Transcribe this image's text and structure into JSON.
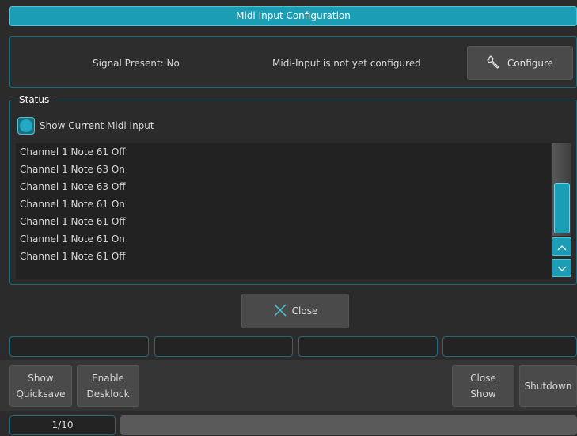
{
  "window": {
    "title": "Midi Input Configuration"
  },
  "top_panel": {
    "signal_text": "Signal Present: No",
    "config_status_text": "Midi-Input is not yet configured",
    "configure_label": "Configure",
    "configure_icon": "wrench-icon"
  },
  "status": {
    "legend": "Status",
    "toggle_label": "Show Current Midi Input",
    "toggle_checked": true,
    "messages": [
      "Channel 1 Note 61 Off",
      "Channel 1 Note 63 On",
      "Channel 1 Note 63 Off",
      "Channel 1 Note 61 On",
      "Channel 1 Note 61 Off",
      "Channel 1 Note 61 On",
      "Channel 1 Note 61 Off"
    ]
  },
  "close_button": {
    "label": "Close",
    "icon": "x-icon"
  },
  "bottom": {
    "show_quicksave": [
      "Show",
      "Quicksave"
    ],
    "enable_desklock": [
      "Enable",
      "Desklock"
    ],
    "close_show": [
      "Close",
      "Show"
    ],
    "shutdown": "Shutdown"
  },
  "footer": {
    "page": "1/10"
  },
  "colors": {
    "accent": "#1a9db5",
    "accent_border": "#4fc3d8",
    "panel_border": "#1d6b7a",
    "background": "#2b2b2b"
  }
}
